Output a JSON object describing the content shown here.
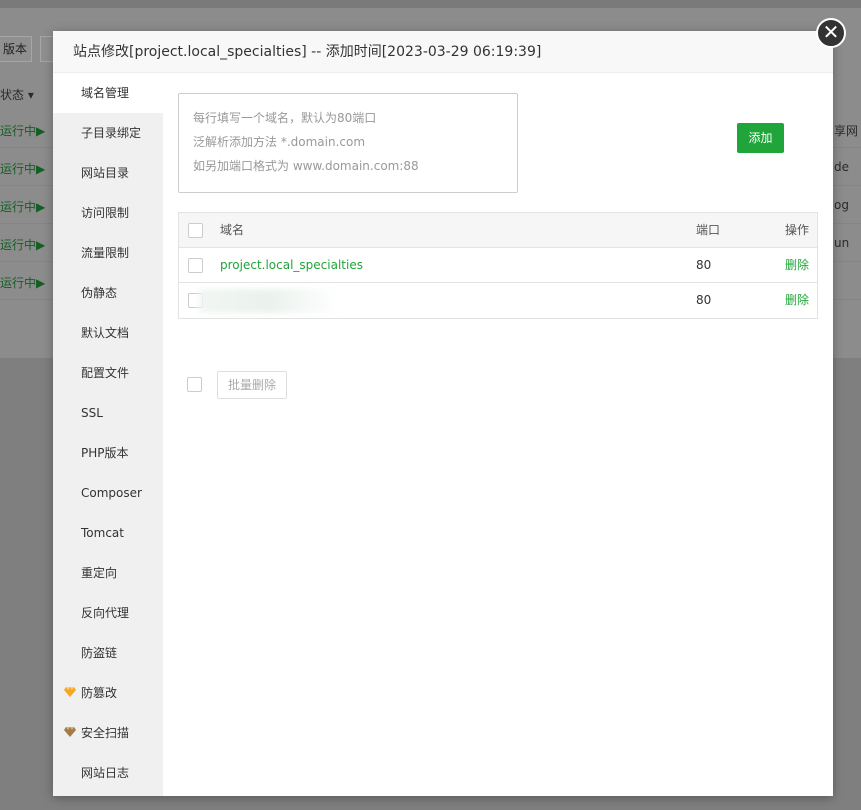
{
  "background": {
    "buttons": [
      "版本"
    ],
    "status_header": "状态",
    "rows": [
      {
        "status": "运行中",
        "right_text": "享网"
      },
      {
        "status": "运行中",
        "right_text": "de"
      },
      {
        "status": "运行中",
        "right_text": "og"
      },
      {
        "status": "运行中",
        "right_text": "un"
      },
      {
        "status": "运行中",
        "right_text": ""
      }
    ]
  },
  "modal": {
    "title": "站点修改[project.local_specialties] -- 添加时间[2023-03-29 06:19:39]",
    "close_icon": "close-icon",
    "sidebar": [
      {
        "label": "域名管理",
        "active": true,
        "icon": ""
      },
      {
        "label": "子目录绑定",
        "icon": ""
      },
      {
        "label": "网站目录",
        "icon": ""
      },
      {
        "label": "访问限制",
        "icon": ""
      },
      {
        "label": "流量限制",
        "icon": ""
      },
      {
        "label": "伪静态",
        "icon": ""
      },
      {
        "label": "默认文档",
        "icon": ""
      },
      {
        "label": "配置文件",
        "icon": ""
      },
      {
        "label": "SSL",
        "icon": ""
      },
      {
        "label": "PHP版本",
        "icon": ""
      },
      {
        "label": "Composer",
        "icon": ""
      },
      {
        "label": "Tomcat",
        "icon": ""
      },
      {
        "label": "重定向",
        "icon": ""
      },
      {
        "label": "反向代理",
        "icon": ""
      },
      {
        "label": "防盗链",
        "icon": ""
      },
      {
        "label": "防篡改",
        "icon": "gem-gold-icon"
      },
      {
        "label": "安全扫描",
        "icon": "gem-brown-icon"
      },
      {
        "label": "网站日志",
        "icon": ""
      }
    ],
    "domain_input": {
      "placeholder_lines": [
        "每行填写一个域名，默认为80端口",
        "泛解析添加方法 *.domain.com",
        "如另加端口格式为 www.domain.com:88"
      ]
    },
    "add_button": "添加",
    "table": {
      "headers": {
        "domain": "域名",
        "port": "端口",
        "action": "操作"
      },
      "rows": [
        {
          "domain": "project.local_specialties",
          "port": "80",
          "action": "删除"
        },
        {
          "domain": "",
          "port": "80",
          "action": "删除"
        }
      ]
    },
    "batch_delete": "批量删除"
  },
  "colors": {
    "accent": "#20a53a",
    "gem_gold": "#f5a623",
    "gem_brown": "#a57a45"
  }
}
